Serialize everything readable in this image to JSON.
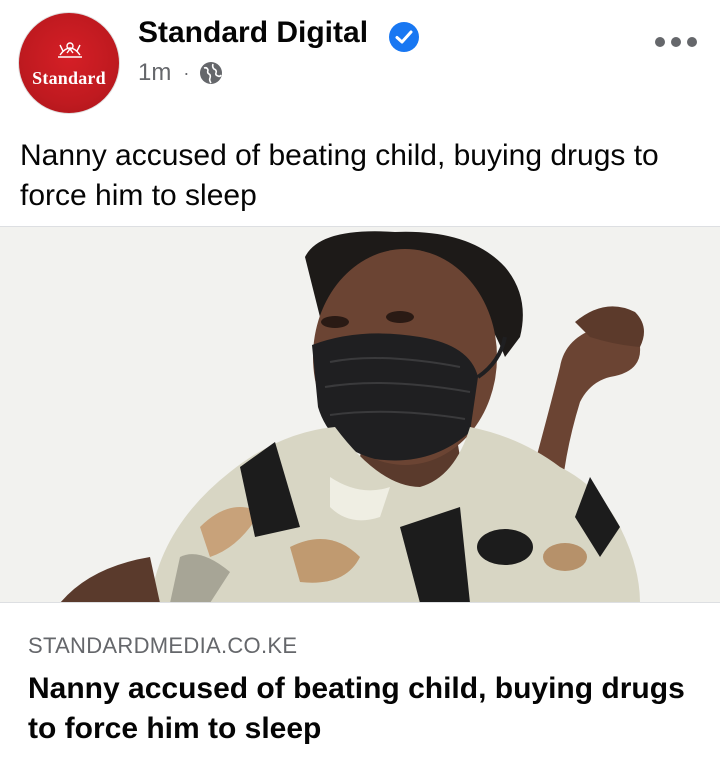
{
  "post": {
    "page_name": "Standard Digital",
    "avatar_text": "Standard",
    "timestamp": "1m",
    "separator": "·",
    "audience_icon": "globe-icon",
    "verified_icon": "verified-badge-icon",
    "more_icon": "more-options-icon",
    "caption": "Nanny accused of beating child, buying drugs to force him to sleep"
  },
  "link_preview": {
    "domain": "STANDARDMEDIA.CO.KE",
    "title": "Nanny accused of beating child, buying drugs to force him to sleep",
    "image_description_icon": "news-photo"
  },
  "colors": {
    "brand_red": "#d51f26",
    "verified_blue": "#1877f2",
    "text_primary": "#050505",
    "text_secondary": "#65676b"
  }
}
